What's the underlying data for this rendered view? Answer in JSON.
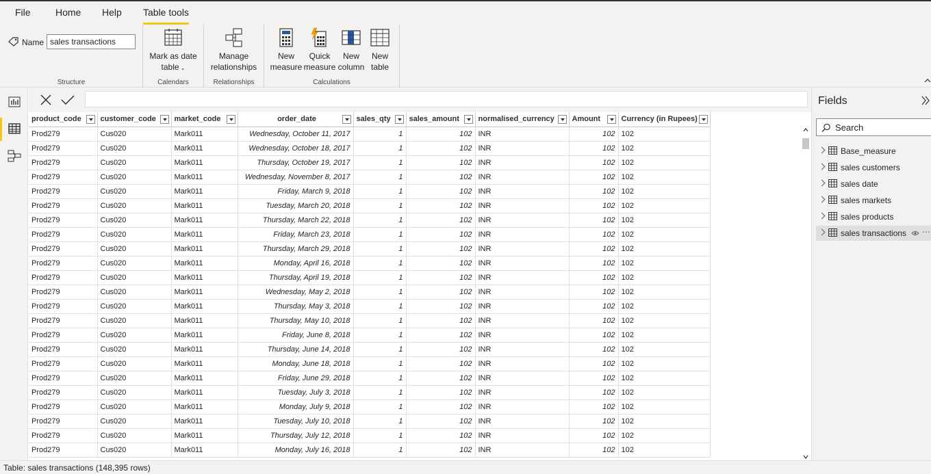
{
  "menu": {
    "tabs": [
      "File",
      "Home",
      "Help",
      "Table tools"
    ],
    "active": "Table tools"
  },
  "ribbon": {
    "name_label": "Name",
    "name_value": "sales transactions",
    "groups": {
      "structure": "Structure",
      "calendars": "Calendars",
      "relationships": "Relationships",
      "calculations": "Calculations"
    },
    "buttons": {
      "mark_date_1": "Mark as date",
      "mark_date_2": "table",
      "manage_rel_1": "Manage",
      "manage_rel_2": "relationships",
      "new_measure_1": "New",
      "new_measure_2": "measure",
      "quick_measure_1": "Quick",
      "quick_measure_2": "measure",
      "new_column_1": "New",
      "new_column_2": "column",
      "new_table_1": "New",
      "new_table_2": "table"
    }
  },
  "table": {
    "columns": [
      "product_code",
      "customer_code",
      "market_code",
      "order_date",
      "sales_qty",
      "sales_amount",
      "normalised_currency",
      "Amount",
      "Currency (in Rupees)"
    ],
    "rows": [
      [
        "Prod279",
        "Cus020",
        "Mark011",
        "Wednesday, October 11, 2017",
        "1",
        "102",
        "INR",
        "102",
        "102"
      ],
      [
        "Prod279",
        "Cus020",
        "Mark011",
        "Wednesday, October 18, 2017",
        "1",
        "102",
        "INR",
        "102",
        "102"
      ],
      [
        "Prod279",
        "Cus020",
        "Mark011",
        "Thursday, October 19, 2017",
        "1",
        "102",
        "INR",
        "102",
        "102"
      ],
      [
        "Prod279",
        "Cus020",
        "Mark011",
        "Wednesday, November 8, 2017",
        "1",
        "102",
        "INR",
        "102",
        "102"
      ],
      [
        "Prod279",
        "Cus020",
        "Mark011",
        "Friday, March 9, 2018",
        "1",
        "102",
        "INR",
        "102",
        "102"
      ],
      [
        "Prod279",
        "Cus020",
        "Mark011",
        "Tuesday, March 20, 2018",
        "1",
        "102",
        "INR",
        "102",
        "102"
      ],
      [
        "Prod279",
        "Cus020",
        "Mark011",
        "Thursday, March 22, 2018",
        "1",
        "102",
        "INR",
        "102",
        "102"
      ],
      [
        "Prod279",
        "Cus020",
        "Mark011",
        "Friday, March 23, 2018",
        "1",
        "102",
        "INR",
        "102",
        "102"
      ],
      [
        "Prod279",
        "Cus020",
        "Mark011",
        "Thursday, March 29, 2018",
        "1",
        "102",
        "INR",
        "102",
        "102"
      ],
      [
        "Prod279",
        "Cus020",
        "Mark011",
        "Monday, April 16, 2018",
        "1",
        "102",
        "INR",
        "102",
        "102"
      ],
      [
        "Prod279",
        "Cus020",
        "Mark011",
        "Thursday, April 19, 2018",
        "1",
        "102",
        "INR",
        "102",
        "102"
      ],
      [
        "Prod279",
        "Cus020",
        "Mark011",
        "Wednesday, May 2, 2018",
        "1",
        "102",
        "INR",
        "102",
        "102"
      ],
      [
        "Prod279",
        "Cus020",
        "Mark011",
        "Thursday, May 3, 2018",
        "1",
        "102",
        "INR",
        "102",
        "102"
      ],
      [
        "Prod279",
        "Cus020",
        "Mark011",
        "Thursday, May 10, 2018",
        "1",
        "102",
        "INR",
        "102",
        "102"
      ],
      [
        "Prod279",
        "Cus020",
        "Mark011",
        "Friday, June 8, 2018",
        "1",
        "102",
        "INR",
        "102",
        "102"
      ],
      [
        "Prod279",
        "Cus020",
        "Mark011",
        "Thursday, June 14, 2018",
        "1",
        "102",
        "INR",
        "102",
        "102"
      ],
      [
        "Prod279",
        "Cus020",
        "Mark011",
        "Monday, June 18, 2018",
        "1",
        "102",
        "INR",
        "102",
        "102"
      ],
      [
        "Prod279",
        "Cus020",
        "Mark011",
        "Friday, June 29, 2018",
        "1",
        "102",
        "INR",
        "102",
        "102"
      ],
      [
        "Prod279",
        "Cus020",
        "Mark011",
        "Tuesday, July 3, 2018",
        "1",
        "102",
        "INR",
        "102",
        "102"
      ],
      [
        "Prod279",
        "Cus020",
        "Mark011",
        "Monday, July 9, 2018",
        "1",
        "102",
        "INR",
        "102",
        "102"
      ],
      [
        "Prod279",
        "Cus020",
        "Mark011",
        "Tuesday, July 10, 2018",
        "1",
        "102",
        "INR",
        "102",
        "102"
      ],
      [
        "Prod279",
        "Cus020",
        "Mark011",
        "Thursday, July 12, 2018",
        "1",
        "102",
        "INR",
        "102",
        "102"
      ],
      [
        "Prod279",
        "Cus020",
        "Mark011",
        "Monday, July 16, 2018",
        "1",
        "102",
        "INR",
        "102",
        "102"
      ]
    ]
  },
  "fields": {
    "title": "Fields",
    "search_placeholder": "Search",
    "items": [
      "Base_measure",
      "sales customers",
      "sales date",
      "sales markets",
      "sales products",
      "sales transactions"
    ],
    "selected": "sales transactions"
  },
  "status": {
    "text": "Table: sales transactions (148,395 rows)"
  },
  "colors": {
    "accent": "#f2c811",
    "ribbon_bg": "#f3f2f1"
  }
}
